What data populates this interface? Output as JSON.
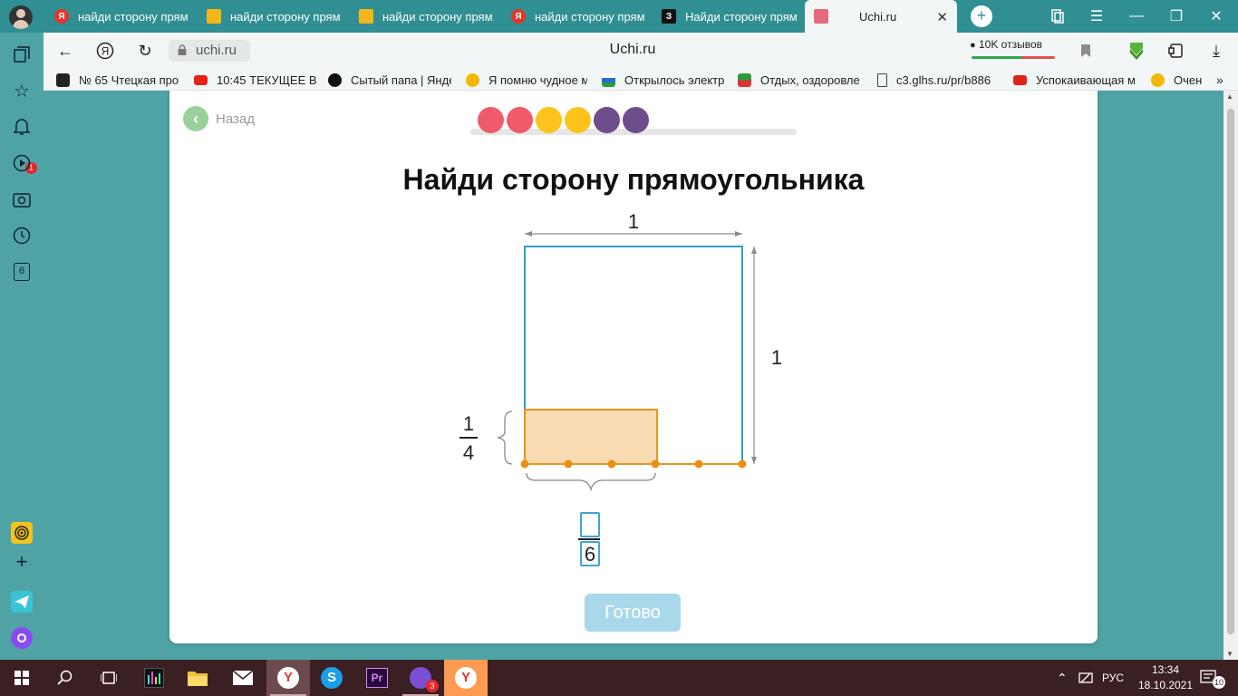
{
  "browser": {
    "tabs": [
      {
        "title": "найди сторону прям",
        "favicon": "yandex-icon",
        "color": "#e8332a",
        "glyph": "Я"
      },
      {
        "title": "найди сторону прям",
        "favicon": "image-icon",
        "color": "#f5b61a",
        "glyph": ""
      },
      {
        "title": "найди сторону прям",
        "favicon": "image-icon",
        "color": "#f5b61a",
        "glyph": ""
      },
      {
        "title": "найди сторону прям",
        "favicon": "yandex-icon",
        "color": "#e8332a",
        "glyph": "Я"
      },
      {
        "title": "Найди сторону прям",
        "favicon": "znanija-icon",
        "color": "#111111",
        "glyph": "З"
      },
      {
        "title": "Uchi.ru",
        "favicon": "uchi-icon",
        "color": "#e46a7c",
        "glyph": ""
      }
    ],
    "url": "uchi.ru",
    "page_title": "Uchi.ru",
    "reviews_label": "10K отзывов",
    "bookmarks": [
      {
        "label": "№ 65 Чтецкая про",
        "icon": "media-icon"
      },
      {
        "label": "10:45 ТЕКУЩЕЕ ВІ",
        "icon": "youtube-icon"
      },
      {
        "label": "Сытый папа | Янде",
        "icon": "zen-icon"
      },
      {
        "label": "Я помню чудное м",
        "icon": "play-icon"
      },
      {
        "label": "Открылось электр",
        "icon": "flag-icon"
      },
      {
        "label": "Отдых, оздоровле",
        "icon": "flag-icon"
      },
      {
        "label": "c3.glhs.ru/pr/b886",
        "icon": "page-icon"
      },
      {
        "label": "Успокаивающая м",
        "icon": "youtube-icon"
      },
      {
        "label": "Очен",
        "icon": "play-icon"
      }
    ],
    "notification_count": "1",
    "sidepanel_counter": "6"
  },
  "page": {
    "back_label": "Назад",
    "progress_dots": [
      "#ef5b6a",
      "#ef5b6a",
      "#fcc41b",
      "#fcc41b",
      "#6e4d8c",
      "#6e4d8c"
    ],
    "title": "Найди сторону прямоугольника",
    "done_label": "Готово"
  },
  "figure": {
    "top_label": "1",
    "right_label": "1",
    "left_fraction": {
      "numerator": "1",
      "denominator": "4"
    },
    "answer_fraction": {
      "numerator": "",
      "denominator": "6"
    },
    "colors": {
      "outline": "#2c9fc9",
      "fill": "#f8dbb3",
      "fill_stroke": "#e8961e",
      "dot": "#ea8e14"
    }
  },
  "taskbar": {
    "language": "РУС",
    "time": "13:34",
    "date": "18.10.2021",
    "notifications": "10",
    "viber_badge": "3"
  }
}
